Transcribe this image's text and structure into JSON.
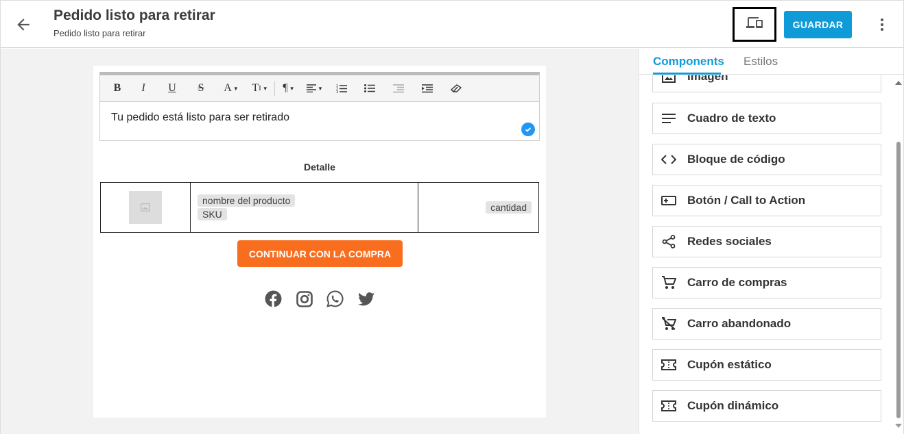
{
  "header": {
    "title": "Pedido listo para retirar",
    "subtitle": "Pedido listo para retirar",
    "save_label": "GUARDAR",
    "accent_color": "#0e9bd8"
  },
  "editor": {
    "toolbar": [
      "bold",
      "italic",
      "underline",
      "strikethrough",
      "font-color",
      "text-size",
      "paragraph",
      "align",
      "ordered-list",
      "unordered-list",
      "outdent",
      "indent",
      "clear-format"
    ],
    "text": "Tu pedido está listo para ser retirado"
  },
  "email": {
    "detail_label": "Detalle",
    "product_name": "nombre del producto",
    "sku": "SKU",
    "quantity": "cantidad",
    "cta_label": "CONTINUAR CON LA COMPRA",
    "cta_color": "#f96d1e",
    "social": [
      "facebook",
      "instagram",
      "whatsapp",
      "twitter"
    ]
  },
  "panel": {
    "tabs": [
      "Components",
      "Estilos"
    ],
    "active_tab": "Components",
    "components": [
      {
        "label": "Imagen",
        "icon": "image-icon"
      },
      {
        "label": "Cuadro de texto",
        "icon": "text-lines-icon"
      },
      {
        "label": "Bloque de código",
        "icon": "code-icon"
      },
      {
        "label": "Botón / Call to Action",
        "icon": "button-icon"
      },
      {
        "label": "Redes sociales",
        "icon": "share-icon"
      },
      {
        "label": "Carro de compras",
        "icon": "cart-icon"
      },
      {
        "label": "Carro abandonado",
        "icon": "cart-off-icon"
      },
      {
        "label": "Cupón estático",
        "icon": "ticket-icon"
      },
      {
        "label": "Cupón dinámico",
        "icon": "ticket-icon"
      }
    ]
  }
}
